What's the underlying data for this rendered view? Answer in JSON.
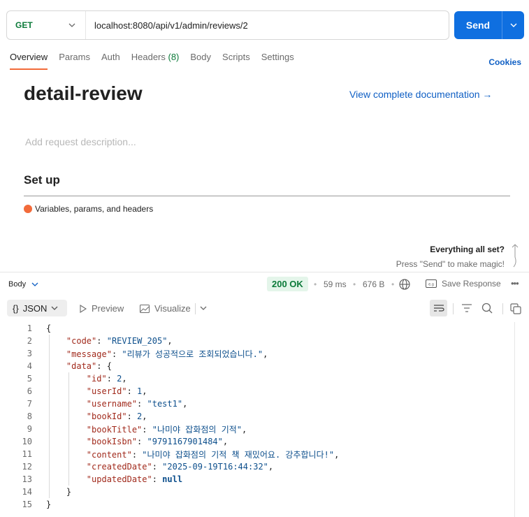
{
  "request": {
    "method": "GET",
    "url": "localhost:8080/api/v1/admin/reviews/2",
    "send_label": "Send"
  },
  "tabs": [
    {
      "label": "Overview"
    },
    {
      "label": "Params"
    },
    {
      "label": "Auth"
    },
    {
      "label": "Headers",
      "count": "(8)"
    },
    {
      "label": "Body"
    },
    {
      "label": "Scripts"
    },
    {
      "label": "Settings"
    }
  ],
  "cookies_label": "Cookies",
  "docs": {
    "title": "detail-review",
    "link": "View complete documentation →",
    "description_placeholder": "Add request description...",
    "setup_heading": "Set up",
    "setup_item": "Variables, params, and headers",
    "allset_title": "Everything all set?",
    "allset_sub": "Press \"Send\" to make magic!"
  },
  "response": {
    "body_label": "Body",
    "status": "200 OK",
    "time": "59 ms",
    "size": "676 B",
    "save_label": "Save Response",
    "format_label": "JSON",
    "preview_label": "Preview",
    "visualize_label": "Visualize"
  },
  "code_lines": [
    {
      "n": "1"
    },
    {
      "n": "2"
    },
    {
      "n": "3"
    },
    {
      "n": "4"
    },
    {
      "n": "5"
    },
    {
      "n": "6"
    },
    {
      "n": "7"
    },
    {
      "n": "8"
    },
    {
      "n": "9"
    },
    {
      "n": "10"
    },
    {
      "n": "11"
    },
    {
      "n": "12"
    },
    {
      "n": "13"
    },
    {
      "n": "14"
    },
    {
      "n": "15"
    }
  ],
  "json": {
    "code_key": "\"code\"",
    "code_val": "\"REVIEW_205\"",
    "message_key": "\"message\"",
    "message_val": "\"리뷰가 성공적으로 조회되었습니다.\"",
    "data_key": "\"data\"",
    "id_key": "\"id\"",
    "id_val": "2",
    "userId_key": "\"userId\"",
    "userId_val": "1",
    "username_key": "\"username\"",
    "username_val": "\"test1\"",
    "bookId_key": "\"bookId\"",
    "bookId_val": "2",
    "bookTitle_key": "\"bookTitle\"",
    "bookTitle_val": "\"나미야 잡화점의 기적\"",
    "bookIsbn_key": "\"bookIsbn\"",
    "bookIsbn_val": "\"9791167901484\"",
    "content_key": "\"content\"",
    "content_val": "\"나미야 잡화점의 기적 책 재밌어요. 강추합니다!\"",
    "createdDate_key": "\"createdDate\"",
    "createdDate_val": "\"2025-09-19T16:44:32\"",
    "updatedDate_key": "\"updatedDate\"",
    "updatedDate_val": "null"
  }
}
